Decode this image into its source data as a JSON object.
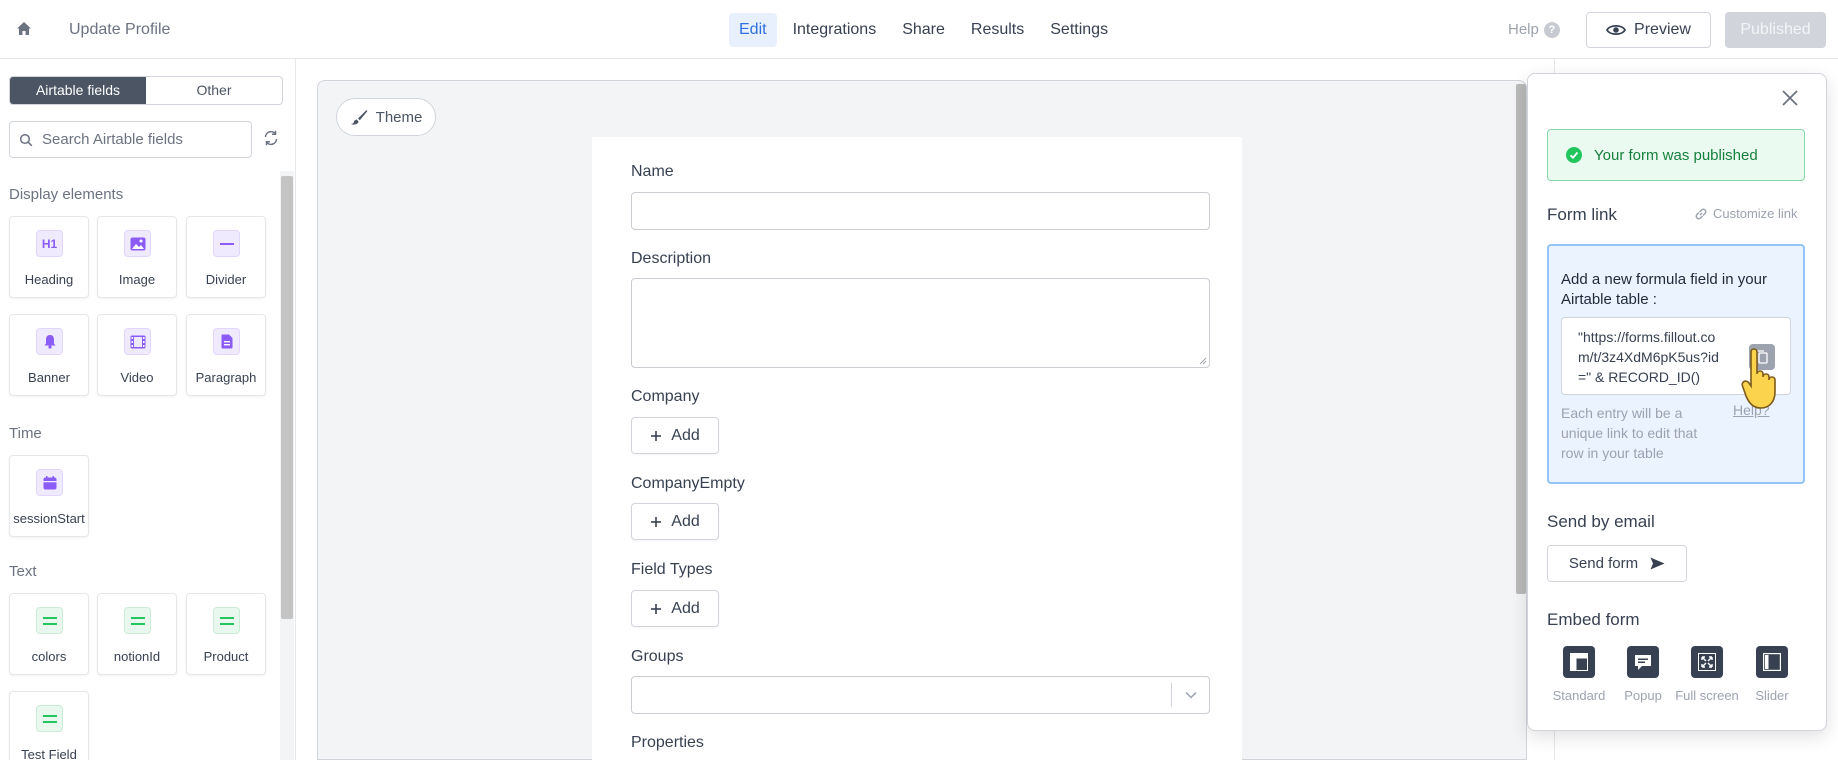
{
  "header": {
    "page_name": "Update Profile",
    "nav": [
      "Edit",
      "Integrations",
      "Share",
      "Results",
      "Settings"
    ],
    "help_label": "Help",
    "preview_label": "Preview",
    "published_label": "Published"
  },
  "sidebar": {
    "tabs": [
      "Airtable fields",
      "Other"
    ],
    "search_placeholder": "Search Airtable fields",
    "sections": {
      "display": "Display elements",
      "time": "Time",
      "text": "Text"
    },
    "display_items": [
      "Heading",
      "Image",
      "Divider",
      "Banner",
      "Video",
      "Paragraph"
    ],
    "time_items": [
      "sessionStart"
    ],
    "text_items": [
      "colors",
      "notionId",
      "Product",
      "Test Field"
    ]
  },
  "canvas": {
    "theme_label": "Theme",
    "fields": {
      "name": "Name",
      "description": "Description",
      "company": "Company",
      "company_empty": "CompanyEmpty",
      "field_types": "Field Types",
      "groups": "Groups",
      "properties": "Properties"
    },
    "add_label": "Add"
  },
  "panel": {
    "success_message": "Your form was published",
    "form_link_title": "Form link",
    "customize_link": "Customize link",
    "info_text": "Add a new formula field in your Airtable table :",
    "formula": "\"https://forms.fillout.com/t/3z4XdM6pK5us?id=\" & RECORD_ID()",
    "note": "Each entry will be a unique link to edit that row in your table",
    "help_link": "Help?",
    "send_title": "Send by email",
    "send_button": "Send form",
    "embed_title": "Embed form",
    "embed_options": [
      "Standard",
      "Popup",
      "Full screen",
      "Slider"
    ]
  },
  "colors": {
    "accent": "#2f6fe0",
    "success": "#15803d",
    "purple_icon": "#8b5cf6",
    "green_icon": "#22c55e"
  }
}
